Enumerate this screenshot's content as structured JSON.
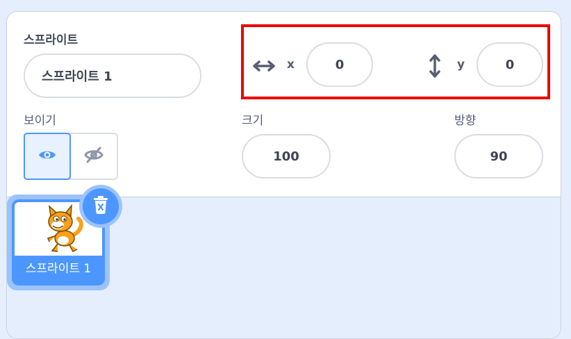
{
  "info": {
    "sprite_label": "스프라이트",
    "sprite_name_value": "스프라이트 1",
    "x_label": "x",
    "x_value": "0",
    "y_label": "y",
    "y_value": "0",
    "show_label": "보이기",
    "size_label": "크기",
    "size_value": "100",
    "direction_label": "방향",
    "direction_value": "90",
    "visible": true
  },
  "sprites": [
    {
      "name": "스프라이트 1",
      "selected": true
    }
  ],
  "icons": {
    "x": "horizontal-arrows-icon",
    "y": "vertical-arrows-icon",
    "show": "eye-icon",
    "hide": "eye-slash-icon",
    "delete": "trash-icon",
    "thumb": "scratch-cat"
  },
  "colors": {
    "accent": "#4c97ff",
    "highlight_frame": "#ee0000",
    "background": "#e5eefc"
  }
}
